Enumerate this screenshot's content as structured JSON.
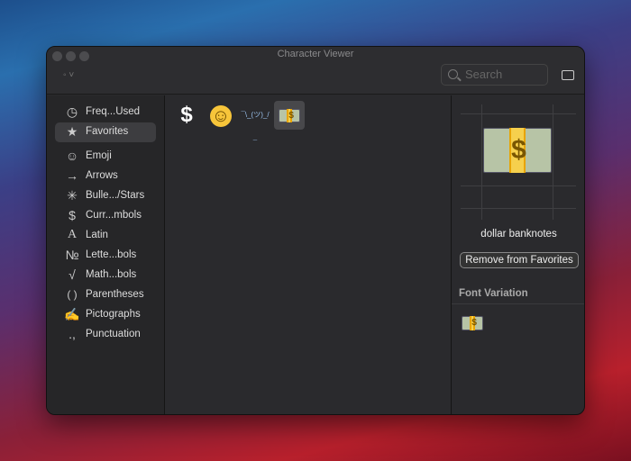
{
  "window": {
    "title": "Character Viewer"
  },
  "toolbar": {
    "font_selector": "◦ ˅",
    "search_placeholder": "Search"
  },
  "sidebar": {
    "items": [
      {
        "label": "Freq...Used",
        "icon": "clock-icon",
        "glyph": "◷"
      },
      {
        "label": "Favorites",
        "icon": "star-icon",
        "glyph": "★",
        "selected": true
      },
      {
        "label": "Emoji",
        "icon": "smiley-icon",
        "glyph": "☺"
      },
      {
        "label": "Arrows",
        "icon": "arrow-icon",
        "glyph": "→"
      },
      {
        "label": "Bulle.../Stars",
        "icon": "asterisk-icon",
        "glyph": "✳"
      },
      {
        "label": "Curr...mbols",
        "icon": "dollar-icon",
        "glyph": "$"
      },
      {
        "label": "Latin",
        "icon": "latin-a-icon",
        "glyph": "A"
      },
      {
        "label": "Lette...bols",
        "icon": "numero-icon",
        "glyph": "№"
      },
      {
        "label": "Math...bols",
        "icon": "sqrt-icon",
        "glyph": "√"
      },
      {
        "label": "Parentheses",
        "icon": "parentheses-icon",
        "glyph": "( )"
      },
      {
        "label": "Pictographs",
        "icon": "pictograph-icon",
        "glyph": "✍"
      },
      {
        "label": "Punctuation",
        "icon": "punctuation-icon",
        "glyph": ".,"
      }
    ]
  },
  "favorites": [
    {
      "name": "dollar-sign",
      "glyph": "$"
    },
    {
      "name": "slightly-smiling-face",
      "glyph": "☺"
    },
    {
      "name": "person-shrugging",
      "glyph": "¯\\_(ツ)_/¯"
    },
    {
      "name": "dollar-banknotes",
      "glyph": "$",
      "selected": true
    }
  ],
  "detail": {
    "name": "dollar banknotes",
    "remove_label": "Remove from Favorites",
    "font_variation_label": "Font Variation",
    "banknote_glyph": "$"
  }
}
